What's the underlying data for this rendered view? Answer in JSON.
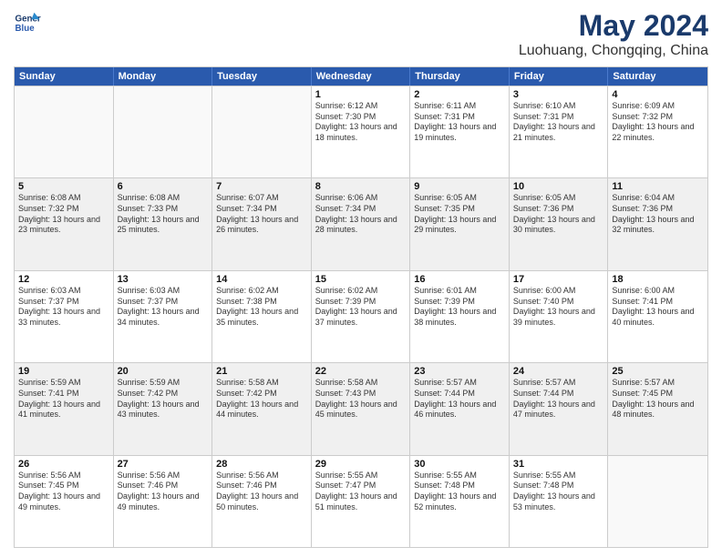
{
  "header": {
    "logo_line1": "General",
    "logo_line2": "Blue",
    "main_title": "May 2024",
    "subtitle": "Luohuang, Chongqing, China"
  },
  "calendar": {
    "days_of_week": [
      "Sunday",
      "Monday",
      "Tuesday",
      "Wednesday",
      "Thursday",
      "Friday",
      "Saturday"
    ],
    "rows": [
      [
        {
          "day": "",
          "empty": true
        },
        {
          "day": "",
          "empty": true
        },
        {
          "day": "",
          "empty": true
        },
        {
          "day": "1",
          "rise": "6:12 AM",
          "set": "7:30 PM",
          "daylight": "13 hours and 18 minutes."
        },
        {
          "day": "2",
          "rise": "6:11 AM",
          "set": "7:31 PM",
          "daylight": "13 hours and 19 minutes."
        },
        {
          "day": "3",
          "rise": "6:10 AM",
          "set": "7:31 PM",
          "daylight": "13 hours and 21 minutes."
        },
        {
          "day": "4",
          "rise": "6:09 AM",
          "set": "7:32 PM",
          "daylight": "13 hours and 22 minutes."
        }
      ],
      [
        {
          "day": "5",
          "rise": "6:08 AM",
          "set": "7:32 PM",
          "daylight": "13 hours and 23 minutes."
        },
        {
          "day": "6",
          "rise": "6:08 AM",
          "set": "7:33 PM",
          "daylight": "13 hours and 25 minutes."
        },
        {
          "day": "7",
          "rise": "6:07 AM",
          "set": "7:34 PM",
          "daylight": "13 hours and 26 minutes."
        },
        {
          "day": "8",
          "rise": "6:06 AM",
          "set": "7:34 PM",
          "daylight": "13 hours and 28 minutes."
        },
        {
          "day": "9",
          "rise": "6:05 AM",
          "set": "7:35 PM",
          "daylight": "13 hours and 29 minutes."
        },
        {
          "day": "10",
          "rise": "6:05 AM",
          "set": "7:36 PM",
          "daylight": "13 hours and 30 minutes."
        },
        {
          "day": "11",
          "rise": "6:04 AM",
          "set": "7:36 PM",
          "daylight": "13 hours and 32 minutes."
        }
      ],
      [
        {
          "day": "12",
          "rise": "6:03 AM",
          "set": "7:37 PM",
          "daylight": "13 hours and 33 minutes."
        },
        {
          "day": "13",
          "rise": "6:03 AM",
          "set": "7:37 PM",
          "daylight": "13 hours and 34 minutes."
        },
        {
          "day": "14",
          "rise": "6:02 AM",
          "set": "7:38 PM",
          "daylight": "13 hours and 35 minutes."
        },
        {
          "day": "15",
          "rise": "6:02 AM",
          "set": "7:39 PM",
          "daylight": "13 hours and 37 minutes."
        },
        {
          "day": "16",
          "rise": "6:01 AM",
          "set": "7:39 PM",
          "daylight": "13 hours and 38 minutes."
        },
        {
          "day": "17",
          "rise": "6:00 AM",
          "set": "7:40 PM",
          "daylight": "13 hours and 39 minutes."
        },
        {
          "day": "18",
          "rise": "6:00 AM",
          "set": "7:41 PM",
          "daylight": "13 hours and 40 minutes."
        }
      ],
      [
        {
          "day": "19",
          "rise": "5:59 AM",
          "set": "7:41 PM",
          "daylight": "13 hours and 41 minutes."
        },
        {
          "day": "20",
          "rise": "5:59 AM",
          "set": "7:42 PM",
          "daylight": "13 hours and 43 minutes."
        },
        {
          "day": "21",
          "rise": "5:58 AM",
          "set": "7:42 PM",
          "daylight": "13 hours and 44 minutes."
        },
        {
          "day": "22",
          "rise": "5:58 AM",
          "set": "7:43 PM",
          "daylight": "13 hours and 45 minutes."
        },
        {
          "day": "23",
          "rise": "5:57 AM",
          "set": "7:44 PM",
          "daylight": "13 hours and 46 minutes."
        },
        {
          "day": "24",
          "rise": "5:57 AM",
          "set": "7:44 PM",
          "daylight": "13 hours and 47 minutes."
        },
        {
          "day": "25",
          "rise": "5:57 AM",
          "set": "7:45 PM",
          "daylight": "13 hours and 48 minutes."
        }
      ],
      [
        {
          "day": "26",
          "rise": "5:56 AM",
          "set": "7:45 PM",
          "daylight": "13 hours and 49 minutes."
        },
        {
          "day": "27",
          "rise": "5:56 AM",
          "set": "7:46 PM",
          "daylight": "13 hours and 49 minutes."
        },
        {
          "day": "28",
          "rise": "5:56 AM",
          "set": "7:46 PM",
          "daylight": "13 hours and 50 minutes."
        },
        {
          "day": "29",
          "rise": "5:55 AM",
          "set": "7:47 PM",
          "daylight": "13 hours and 51 minutes."
        },
        {
          "day": "30",
          "rise": "5:55 AM",
          "set": "7:48 PM",
          "daylight": "13 hours and 52 minutes."
        },
        {
          "day": "31",
          "rise": "5:55 AM",
          "set": "7:48 PM",
          "daylight": "13 hours and 53 minutes."
        },
        {
          "day": "",
          "empty": true
        }
      ]
    ]
  }
}
